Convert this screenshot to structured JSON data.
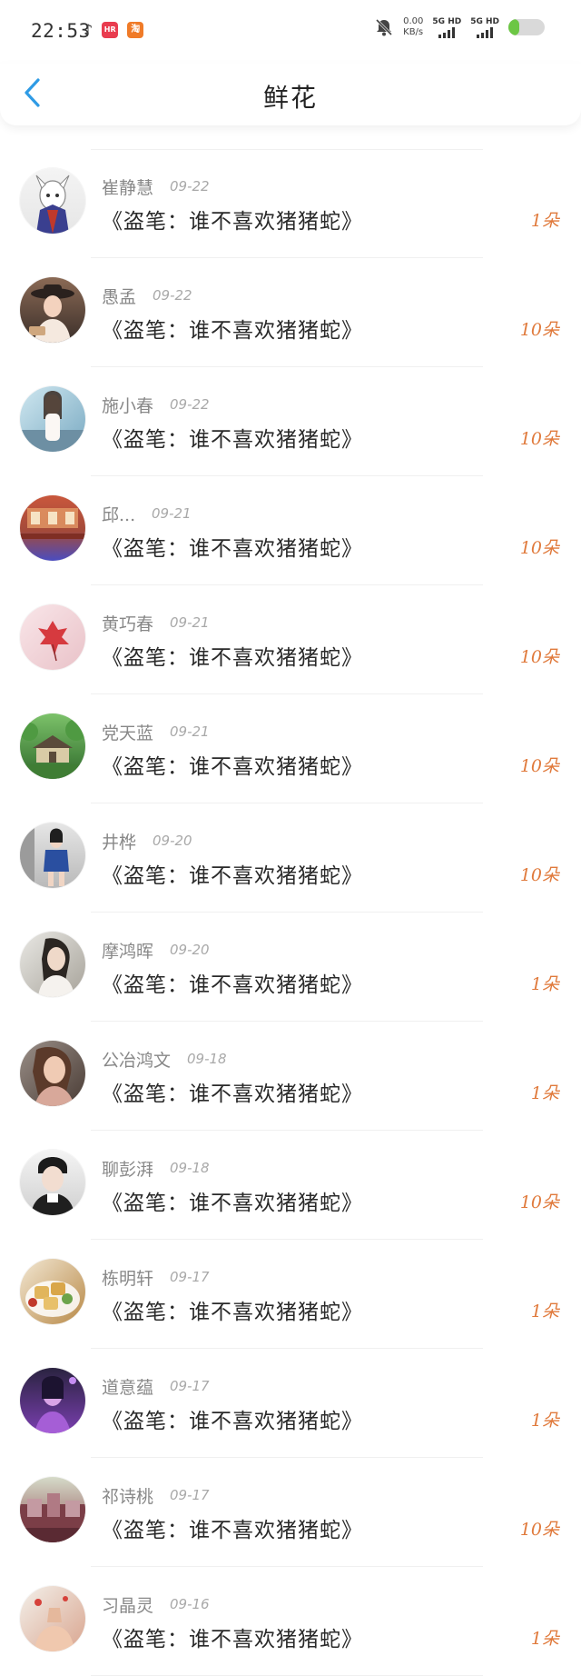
{
  "status_bar": {
    "time": "22:53",
    "tiny_note": "♪",
    "app_badge_1": "HR",
    "app_badge_2": "淘",
    "net_speed_value": "0.00",
    "net_speed_unit": "KB/s",
    "sim1": "5G HD",
    "sim2": "5G HD",
    "battery_level": 0.3,
    "icons": [
      "music-note-icon",
      "app-badge-icon",
      "taobao-icon",
      "silent-bell-icon",
      "signal-icon",
      "battery-icon"
    ]
  },
  "header": {
    "title": "鲜花",
    "back_icon": "chevron-left-icon",
    "accent": "#2f9be5"
  },
  "colors": {
    "flower_count": "#e07a3c",
    "name": "#888888",
    "date": "#a9a9a9"
  },
  "items": [
    {
      "name": "崔静慧",
      "date": "09-22",
      "book": "《盗笔：谁不喜欢猪猪蛇》",
      "count": "1朵"
    },
    {
      "name": "愚孟",
      "date": "09-22",
      "book": "《盗笔：谁不喜欢猪猪蛇》",
      "count": "10朵"
    },
    {
      "name": "施小春",
      "date": "09-22",
      "book": "《盗笔：谁不喜欢猪猪蛇》",
      "count": "10朵"
    },
    {
      "name": "邱...",
      "date": "09-21",
      "book": "《盗笔：谁不喜欢猪猪蛇》",
      "count": "10朵"
    },
    {
      "name": "黄巧春",
      "date": "09-21",
      "book": "《盗笔：谁不喜欢猪猪蛇》",
      "count": "10朵"
    },
    {
      "name": "党天蓝",
      "date": "09-21",
      "book": "《盗笔：谁不喜欢猪猪蛇》",
      "count": "10朵"
    },
    {
      "name": "井桦",
      "date": "09-20",
      "book": "《盗笔：谁不喜欢猪猪蛇》",
      "count": "10朵"
    },
    {
      "name": "摩鸿晖",
      "date": "09-20",
      "book": "《盗笔：谁不喜欢猪猪蛇》",
      "count": "1朵"
    },
    {
      "name": "公冶鸿文",
      "date": "09-18",
      "book": "《盗笔：谁不喜欢猪猪蛇》",
      "count": "1朵"
    },
    {
      "name": "聊彭湃",
      "date": "09-18",
      "book": "《盗笔：谁不喜欢猪猪蛇》",
      "count": "10朵"
    },
    {
      "name": "栋明轩",
      "date": "09-17",
      "book": "《盗笔：谁不喜欢猪猪蛇》",
      "count": "1朵"
    },
    {
      "name": "道意蕴",
      "date": "09-17",
      "book": "《盗笔：谁不喜欢猪猪蛇》",
      "count": "1朵"
    },
    {
      "name": "祁诗桃",
      "date": "09-17",
      "book": "《盗笔：谁不喜欢猪猪蛇》",
      "count": "10朵"
    },
    {
      "name": "习晶灵",
      "date": "09-16",
      "book": "《盗笔：谁不喜欢猪猪蛇》",
      "count": "1朵"
    }
  ]
}
